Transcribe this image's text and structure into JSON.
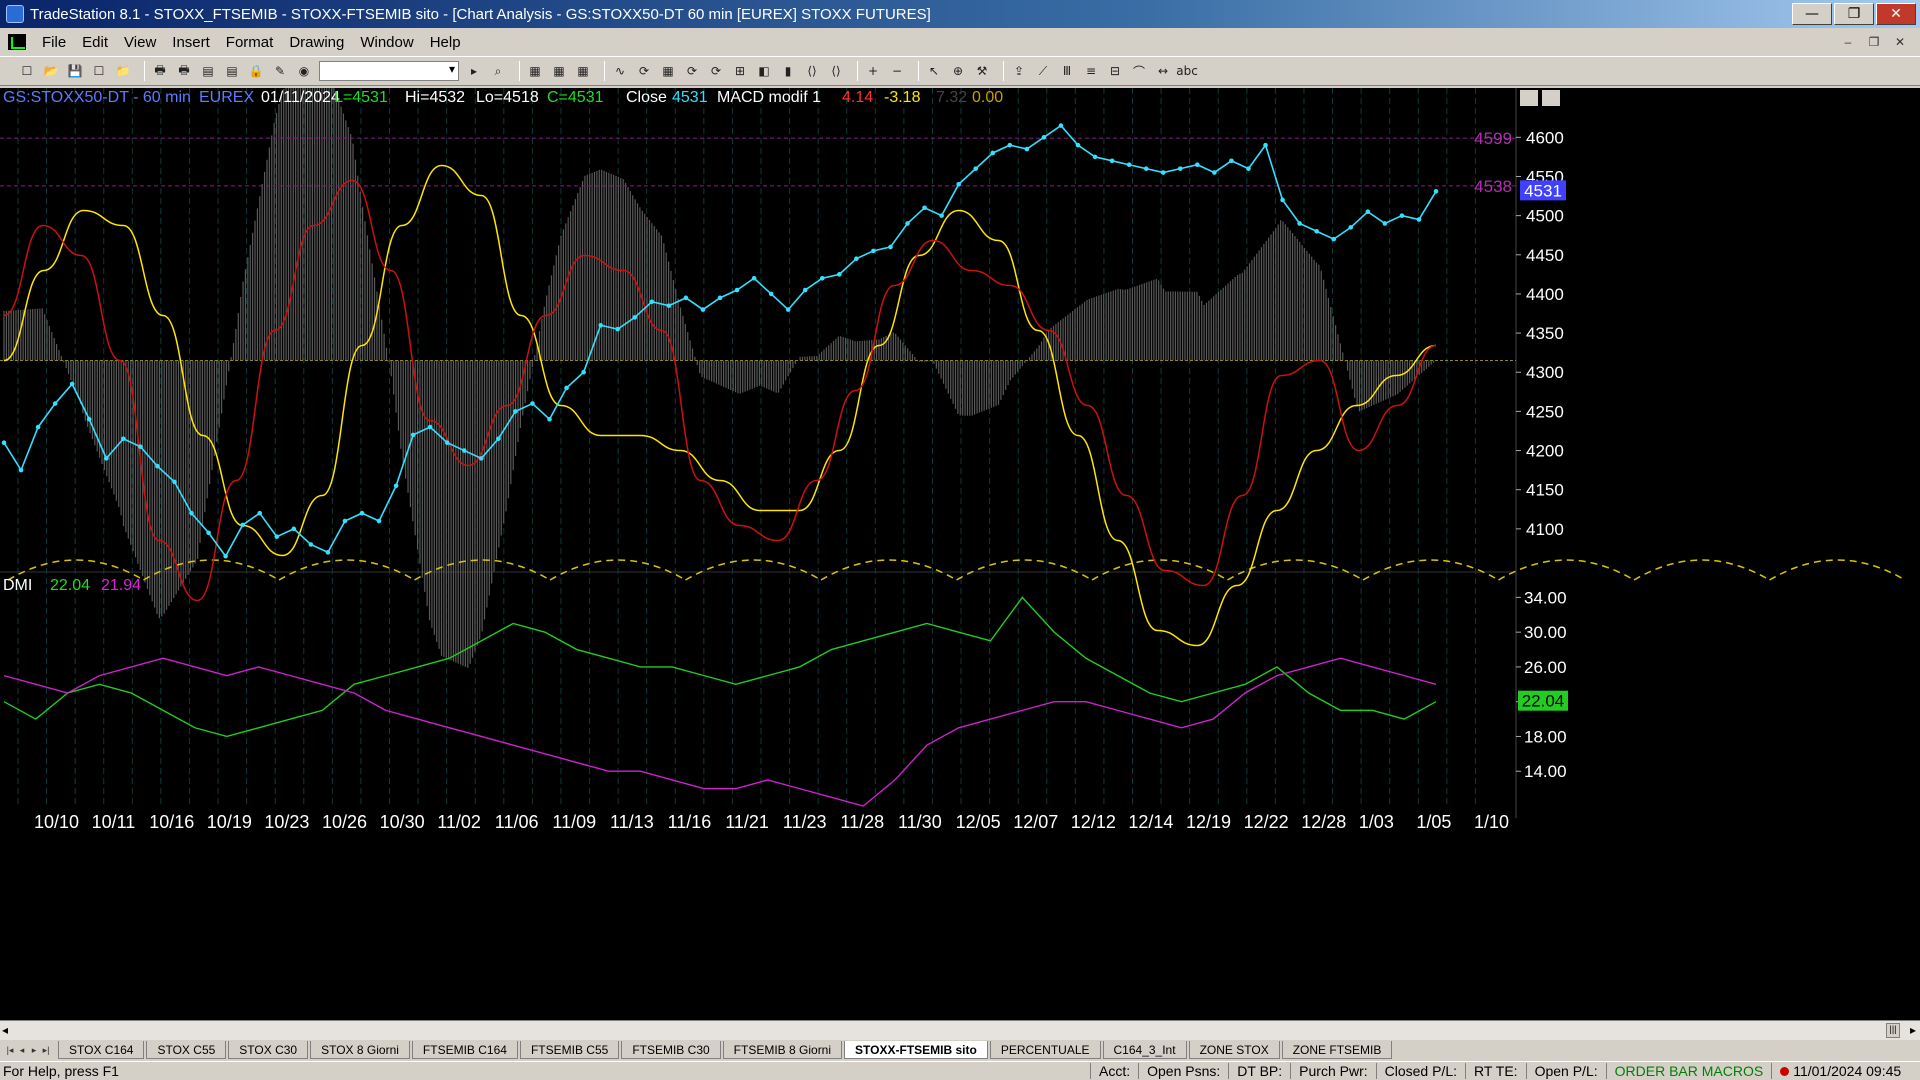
{
  "window": {
    "title": "TradeStation 8.1 - STOXX_FTSEMIB - STOXX-FTSEMIB sito - [Chart Analysis - GS:STOXX50-DT  60 min  [EUREX] STOXX FUTURES]",
    "minimize": "—",
    "restore": "❐",
    "close": "✕"
  },
  "menu": {
    "items": [
      "File",
      "Edit",
      "View",
      "Insert",
      "Format",
      "Drawing",
      "Window",
      "Help"
    ],
    "mdi": [
      "–",
      "❐",
      "✕"
    ]
  },
  "toolbar": {
    "icons": [
      "new-icon",
      "open-icon",
      "save-all-icon",
      "new-workspace-icon",
      "folder-icon",
      "print-icon",
      "print-preview-icon",
      "window-icon",
      "window2-icon",
      "lock-icon",
      "tools-icon",
      "globe-icon",
      "symbol-combo",
      "arrow-icon",
      "find-icon",
      "grid1-icon",
      "grid2-icon",
      "table-icon",
      "chart1-icon",
      "chart2-icon",
      "chart3-icon",
      "chart4-icon",
      "chart5-icon",
      "chart6-icon",
      "chart7-icon",
      "chart8-icon",
      "chart9-icon",
      "chart10-icon",
      "zoom-in-icon",
      "zoom-out-icon",
      "pointer-icon",
      "crosshair-icon",
      "hammer-icon",
      "export-icon",
      "line-icon",
      "fib-icon",
      "hline-icon",
      "channel-icon",
      "trend-icon",
      "arrow-draw-icon",
      "text-icon"
    ],
    "glyphs": [
      "☐",
      "📂",
      "💾",
      "☐",
      "📁",
      "🖶",
      "🖶",
      "▤",
      "▤",
      "🔒",
      "✎",
      "◉",
      "",
      "▸",
      "⌕",
      "▦",
      "▦",
      "▦",
      "∿",
      "⟳",
      "▦",
      "⟳",
      "⟳",
      "⊞",
      "◧",
      "▮",
      "⟨⟩",
      "⟨⟩",
      "+",
      "−",
      "↖",
      "⊕",
      "⚒",
      "⇪",
      "⟋",
      "Ⅲ",
      "≡",
      "⊟",
      "⌒",
      "↔",
      "abc"
    ]
  },
  "chart_header": {
    "symbol": "GS:STOXX50-DT - 60 min",
    "exchange": "EUREX",
    "date": "01/11/2024",
    "last": "L=4531",
    "high": "Hi=4532",
    "low": "Lo=4518",
    "close": "C=4531",
    "close_label": "Close",
    "close_value": "4531",
    "macd_name": "MACD modif 1",
    "macd_v1": "4.14",
    "macd_v2": "-3.18",
    "macd_v3": "7.32",
    "macd_v4": "0.00"
  },
  "dmi_header": {
    "name": "DMI",
    "plus": "22.04",
    "minus": "21.94"
  },
  "colors": {
    "background": "#000000",
    "price": "#33e0ff",
    "macd_red": "#cc1111",
    "macd_yellow": "#ffe600",
    "histogram": "#5a5a5a",
    "dmi_plus": "#22cc22",
    "dmi_minus": "#cc22cc",
    "price_marker_bg": "#4040ff",
    "dmi_marker_bg": "#22cc22"
  },
  "chart_data": [
    {
      "type": "line",
      "name_pane": "price",
      "ylim": [
        4050,
        4640
      ],
      "y_ticks": [
        4100,
        4150,
        4200,
        4250,
        4300,
        4350,
        4400,
        4450,
        4500,
        4550,
        4600
      ],
      "x_labels": [
        "10/10",
        "10/11",
        "10/16",
        "10/19",
        "10/23",
        "10/26",
        "10/30",
        "11/02",
        "11/06",
        "11/09",
        "11/13",
        "11/16",
        "11/21",
        "11/23",
        "11/28",
        "11/30",
        "12/05",
        "12/07",
        "12/12",
        "12/14",
        "12/19",
        "12/22",
        "12/28",
        "1/03",
        "1/05",
        "1/10"
      ],
      "reference_lines": [
        {
          "label": "4599",
          "value": 4599
        },
        {
          "label": "4538",
          "value": 4538
        }
      ],
      "last_value_label": "4531",
      "series": [
        {
          "color": "#33e0ff",
          "values": [
            4210,
            4175,
            4230,
            4260,
            4285,
            4240,
            4190,
            4215,
            4205,
            4180,
            4160,
            4120,
            4095,
            4065,
            4105,
            4120,
            4090,
            4100,
            4080,
            4070,
            4110,
            4120,
            4110,
            4155,
            4220,
            4230,
            4210,
            4200,
            4190,
            4215,
            4250,
            4260,
            4240,
            4280,
            4300,
            4360,
            4355,
            4370,
            4390,
            4385,
            4395,
            4380,
            4395,
            4405,
            4420,
            4400,
            4380,
            4405,
            4420,
            4425,
            4445,
            4455,
            4460,
            4490,
            4510,
            4500,
            4540,
            4560,
            4580,
            4590,
            4585,
            4600,
            4615,
            4590,
            4575,
            4570,
            4565,
            4560,
            4555,
            4560,
            4565,
            4555,
            4570,
            4560,
            4590,
            4520,
            4490,
            4480,
            4470,
            4485,
            4505,
            4490,
            4500,
            4495,
            4531
          ]
        }
      ]
    },
    {
      "type": "line",
      "name_pane": "macd-oscillator",
      "series": [
        {
          "color": "#ffe600",
          "values": [
            0.0,
            0.6,
            1.0,
            0.9,
            0.3,
            -0.5,
            -1.1,
            -1.3,
            -0.9,
            0.1,
            0.9,
            1.3,
            1.1,
            0.3,
            -0.3,
            -0.5,
            -0.5,
            -0.6,
            -0.8,
            -1.0,
            -1.0,
            -0.6,
            0.1,
            0.7,
            1.0,
            0.8,
            0.2,
            -0.5,
            -1.2,
            -1.8,
            -1.9,
            -1.5,
            -1.0,
            -0.6,
            -0.3,
            -0.1,
            0.1
          ]
        },
        {
          "color": "#cc1111",
          "values": [
            0.3,
            0.9,
            0.7,
            0.0,
            -1.2,
            -1.6,
            -0.8,
            0.2,
            0.9,
            1.2,
            0.6,
            -0.4,
            -0.7,
            -0.3,
            0.3,
            0.7,
            0.6,
            0.2,
            -0.8,
            -1.1,
            -1.2,
            -0.8,
            -0.2,
            0.5,
            0.8,
            0.6,
            0.5,
            0.2,
            -0.3,
            -0.9,
            -1.4,
            -1.5,
            -0.9,
            -0.1,
            0.0,
            -0.6,
            -0.3,
            0.1
          ]
        }
      ]
    },
    {
      "type": "line",
      "name_pane": "dmi",
      "ylim": [
        10,
        36
      ],
      "y_ticks": [
        14,
        18,
        22,
        26,
        30,
        34
      ],
      "y_tick_labels": [
        "14.00",
        "18.00",
        "22.00",
        "26.00",
        "30.00",
        "34.00"
      ],
      "last_value_label": "22.04",
      "series": [
        {
          "name": "DMI+",
          "color": "#22cc22",
          "values": [
            22,
            20,
            23,
            24,
            23,
            21,
            19,
            18,
            19,
            20,
            21,
            24,
            25,
            26,
            27,
            29,
            31,
            30,
            28,
            27,
            26,
            26,
            25,
            24,
            25,
            26,
            28,
            29,
            30,
            31,
            30,
            29,
            34,
            30,
            27,
            25,
            23,
            22,
            23,
            24,
            26,
            23,
            21,
            21,
            20,
            22
          ]
        },
        {
          "name": "DMI-",
          "color": "#cc22cc",
          "values": [
            25,
            24,
            23,
            25,
            26,
            27,
            26,
            25,
            26,
            25,
            24,
            23,
            21,
            20,
            19,
            18,
            17,
            16,
            15,
            14,
            14,
            13,
            12,
            12,
            13,
            12,
            11,
            10,
            13,
            17,
            19,
            20,
            21,
            22,
            22,
            21,
            20,
            19,
            20,
            23,
            25,
            26,
            27,
            26,
            25,
            24
          ]
        }
      ]
    }
  ],
  "tabs": {
    "items": [
      "STOX C164",
      "STOX C55",
      "STOX  C30",
      "STOX  8 Giorni",
      "FTSEMIB C164",
      "FTSEMIB C55",
      "FTSEMIB C30",
      "FTSEMIB  8 Giorni",
      "STOXX-FTSEMIB sito",
      "PERCENTUALE",
      "C164_3_Int",
      "ZONE STOX",
      "ZONE FTSEMIB"
    ],
    "active": "STOXX-FTSEMIB sito"
  },
  "status": {
    "help": "For Help, press F1",
    "acct": "Acct:",
    "open_psns": "Open Psns:",
    "dt_bp": "DT BP:",
    "purch_pwr": "Purch Pwr:",
    "closed_pl": "Closed P/L:",
    "rt_te": "RT TE:",
    "open_pl": "Open P/L:",
    "macros": "ORDER BAR  MACROS",
    "datetime": "11/01/2024 09:45"
  }
}
